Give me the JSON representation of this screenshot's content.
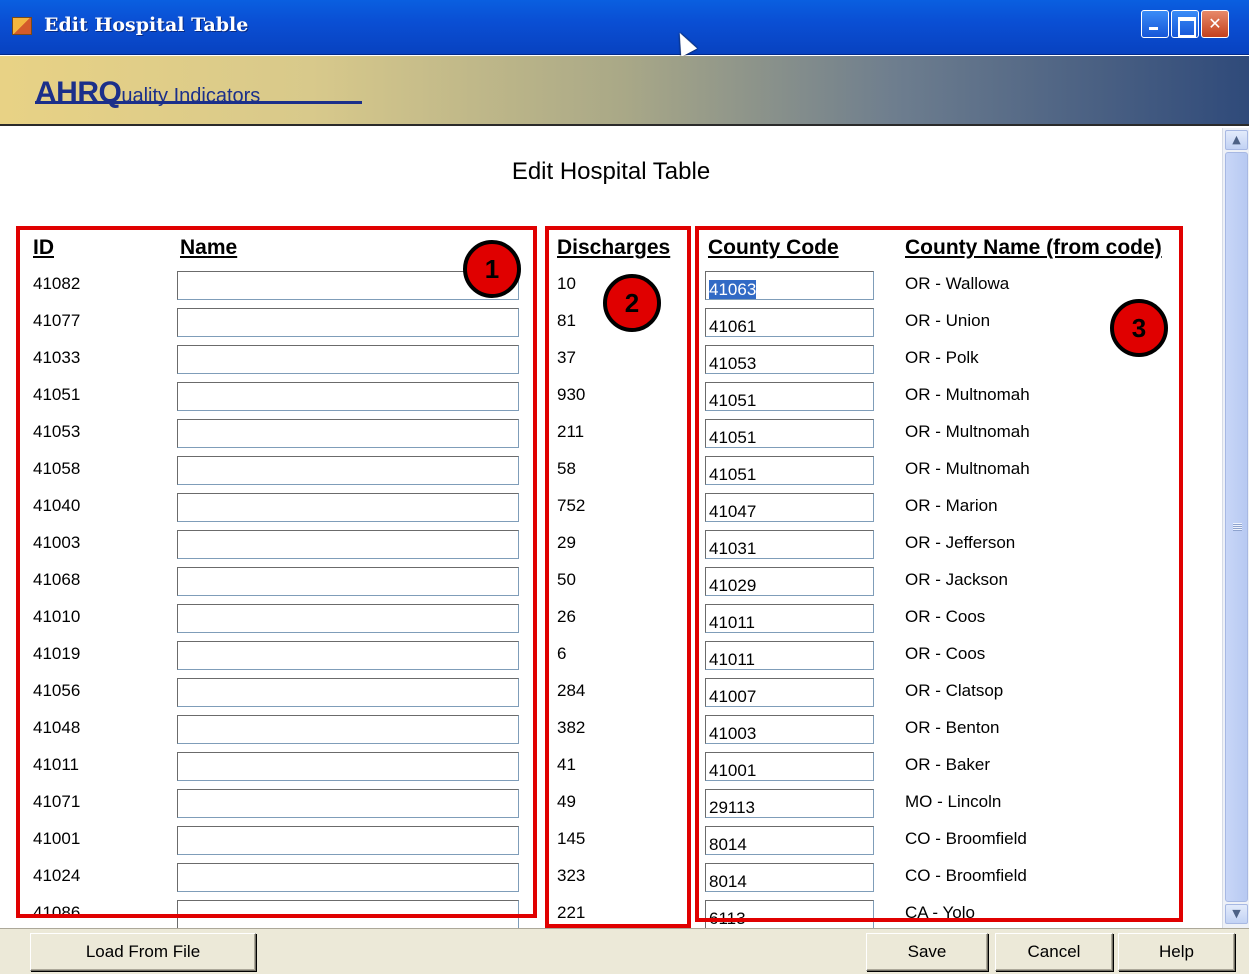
{
  "window": {
    "title": "Edit Hospital Table"
  },
  "banner": {
    "logo_big": "AHRQ",
    "logo_small": "uality Indicators"
  },
  "page": {
    "heading": "Edit Hospital Table"
  },
  "columns": {
    "id": "ID",
    "name": "Name",
    "discharges": "Discharges",
    "county_code": "County Code",
    "county_name": "County Name (from code)"
  },
  "rows": [
    {
      "id": "41082",
      "name": "",
      "discharges": "10",
      "county_code": "41063",
      "county_name": "OR - Wallowa"
    },
    {
      "id": "41077",
      "name": "",
      "discharges": "81",
      "county_code": "41061",
      "county_name": "OR - Union"
    },
    {
      "id": "41033",
      "name": "",
      "discharges": "37",
      "county_code": "41053",
      "county_name": "OR - Polk"
    },
    {
      "id": "41051",
      "name": "",
      "discharges": "930",
      "county_code": "41051",
      "county_name": "OR - Multnomah"
    },
    {
      "id": "41053",
      "name": "",
      "discharges": "211",
      "county_code": "41051",
      "county_name": "OR - Multnomah"
    },
    {
      "id": "41058",
      "name": "",
      "discharges": "58",
      "county_code": "41051",
      "county_name": "OR - Multnomah"
    },
    {
      "id": "41040",
      "name": "",
      "discharges": "752",
      "county_code": "41047",
      "county_name": "OR - Marion"
    },
    {
      "id": "41003",
      "name": "",
      "discharges": "29",
      "county_code": "41031",
      "county_name": "OR - Jefferson"
    },
    {
      "id": "41068",
      "name": "",
      "discharges": "50",
      "county_code": "41029",
      "county_name": "OR - Jackson"
    },
    {
      "id": "41010",
      "name": "",
      "discharges": "26",
      "county_code": "41011",
      "county_name": "OR - Coos"
    },
    {
      "id": "41019",
      "name": "",
      "discharges": "6",
      "county_code": "41011",
      "county_name": "OR - Coos"
    },
    {
      "id": "41056",
      "name": "",
      "discharges": "284",
      "county_code": "41007",
      "county_name": "OR - Clatsop"
    },
    {
      "id": "41048",
      "name": "",
      "discharges": "382",
      "county_code": "41003",
      "county_name": "OR - Benton"
    },
    {
      "id": "41011",
      "name": "",
      "discharges": "41",
      "county_code": "41001",
      "county_name": "OR - Baker"
    },
    {
      "id": "41071",
      "name": "",
      "discharges": "49",
      "county_code": "29113",
      "county_name": "MO - Lincoln"
    },
    {
      "id": "41001",
      "name": "",
      "discharges": "145",
      "county_code": "8014",
      "county_name": "CO - Broomfield"
    },
    {
      "id": "41024",
      "name": "",
      "discharges": "323",
      "county_code": "8014",
      "county_name": "CO - Broomfield"
    },
    {
      "id": "41086",
      "name": "",
      "discharges": "221",
      "county_code": "6113",
      "county_name": "CA - Yolo"
    }
  ],
  "callouts": [
    "1",
    "2",
    "3"
  ],
  "buttons": {
    "load": "Load From File",
    "save": "Save",
    "cancel": "Cancel",
    "help": "Help"
  },
  "icons": {
    "app": "app-window-icon",
    "minimize": "minimize-icon",
    "maximize": "maximize-icon",
    "close": "close-icon",
    "cursor": "mouse-pointer-icon"
  },
  "colors": {
    "annotation": "#e00000",
    "title_bar": "#0a4fd4",
    "selection": "#316ac5"
  }
}
